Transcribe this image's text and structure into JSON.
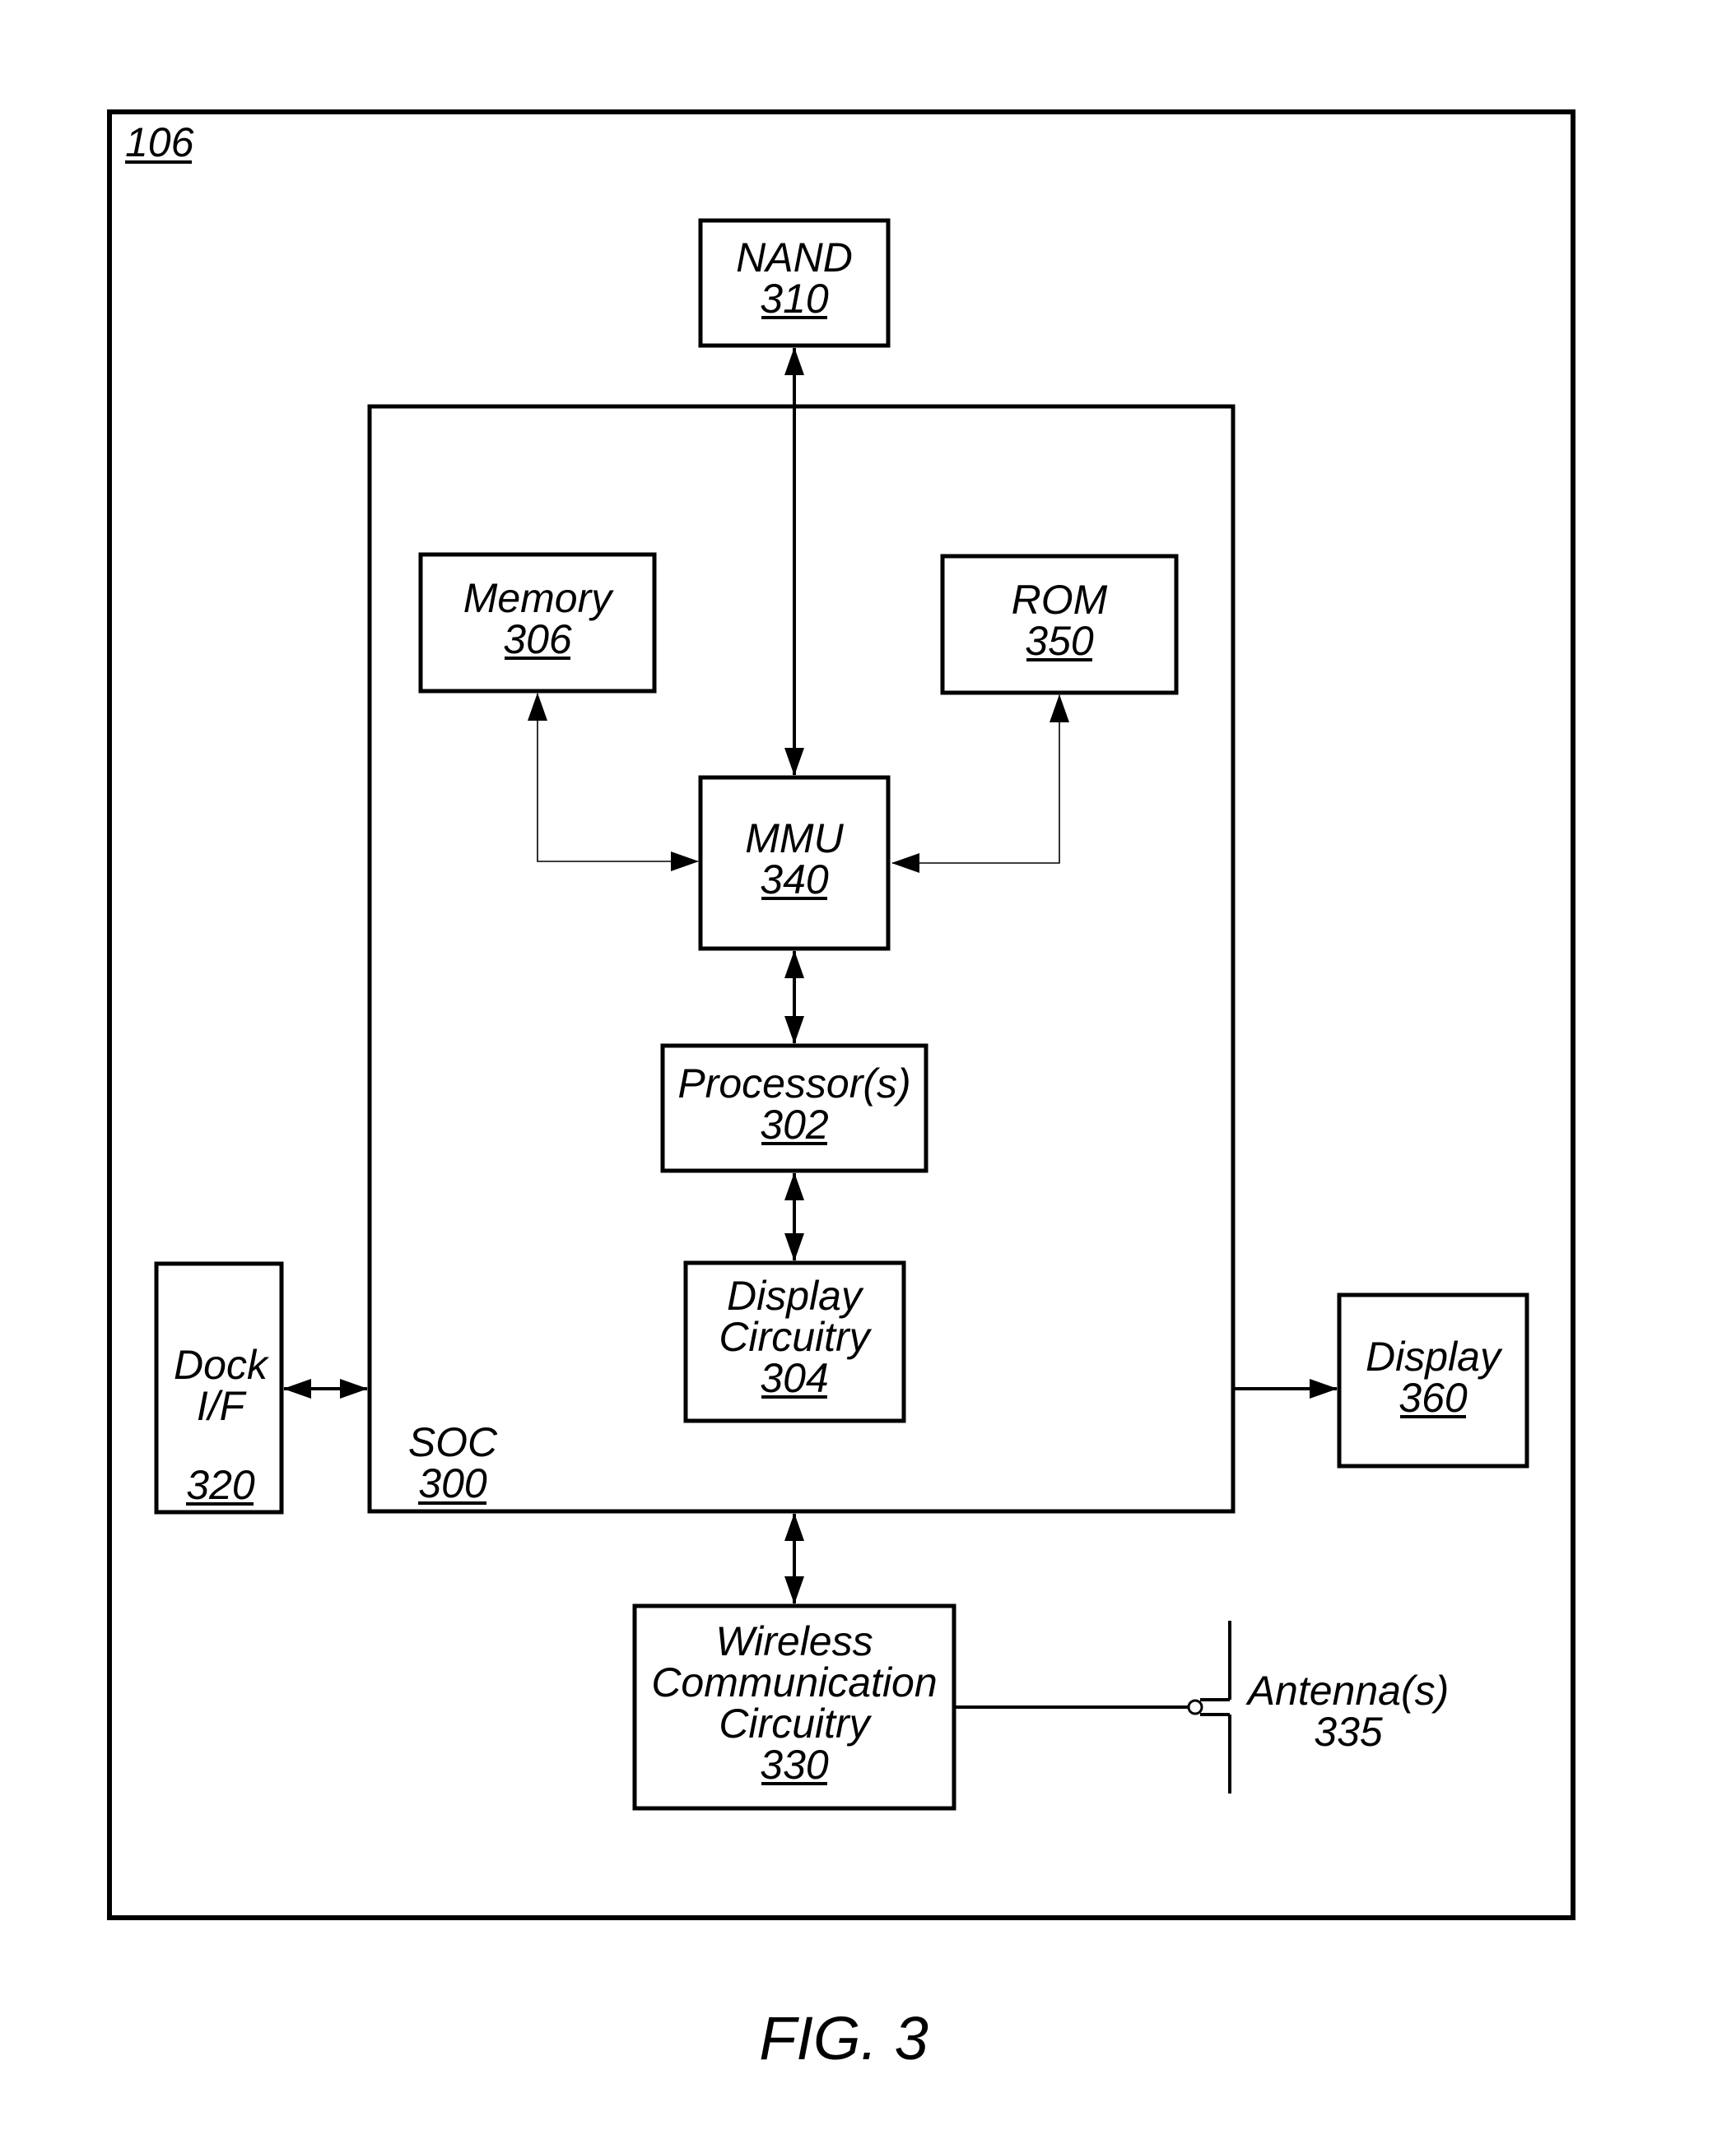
{
  "figure": {
    "caption": "FIG. 3",
    "device_ref": "106"
  },
  "blocks": {
    "nand": {
      "name": "NAND",
      "ref": "310"
    },
    "soc": {
      "name": "SOC",
      "ref": "300"
    },
    "memory": {
      "name": "Memory",
      "ref": "306"
    },
    "rom": {
      "name": "ROM",
      "ref": "350"
    },
    "mmu": {
      "name": "MMU",
      "ref": "340"
    },
    "processor": {
      "name": "Processor(s)",
      "ref": "302"
    },
    "display_circuitry": {
      "name_line1": "Display",
      "name_line2": "Circuitry",
      "ref": "304"
    },
    "dock": {
      "name_line1": "Dock",
      "name_line2": "I/F",
      "ref": "320"
    },
    "display": {
      "name": "Display",
      "ref": "360"
    },
    "wireless": {
      "name_line1": "Wireless",
      "name_line2": "Communication",
      "name_line3": "Circuitry",
      "ref": "330"
    },
    "antenna": {
      "name": "Antenna(s)",
      "ref": "335"
    }
  },
  "connections": [
    {
      "from": "NAND 310",
      "to": "MMU 340",
      "direction": "bidirectional"
    },
    {
      "from": "Memory 306",
      "to": "MMU 340",
      "direction": "bidirectional"
    },
    {
      "from": "ROM 350",
      "to": "MMU 340",
      "direction": "bidirectional"
    },
    {
      "from": "MMU 340",
      "to": "Processor(s) 302",
      "direction": "bidirectional"
    },
    {
      "from": "Processor(s) 302",
      "to": "Display Circuitry 304",
      "direction": "bidirectional"
    },
    {
      "from": "Dock I/F 320",
      "to": "SOC 300",
      "direction": "bidirectional"
    },
    {
      "from": "SOC 300",
      "to": "Display 360",
      "direction": "unidirectional"
    },
    {
      "from": "SOC 300",
      "to": "Wireless Communication Circuitry 330",
      "direction": "bidirectional"
    },
    {
      "from": "Wireless Communication Circuitry 330",
      "to": "Antenna(s) 335",
      "direction": "line"
    }
  ]
}
